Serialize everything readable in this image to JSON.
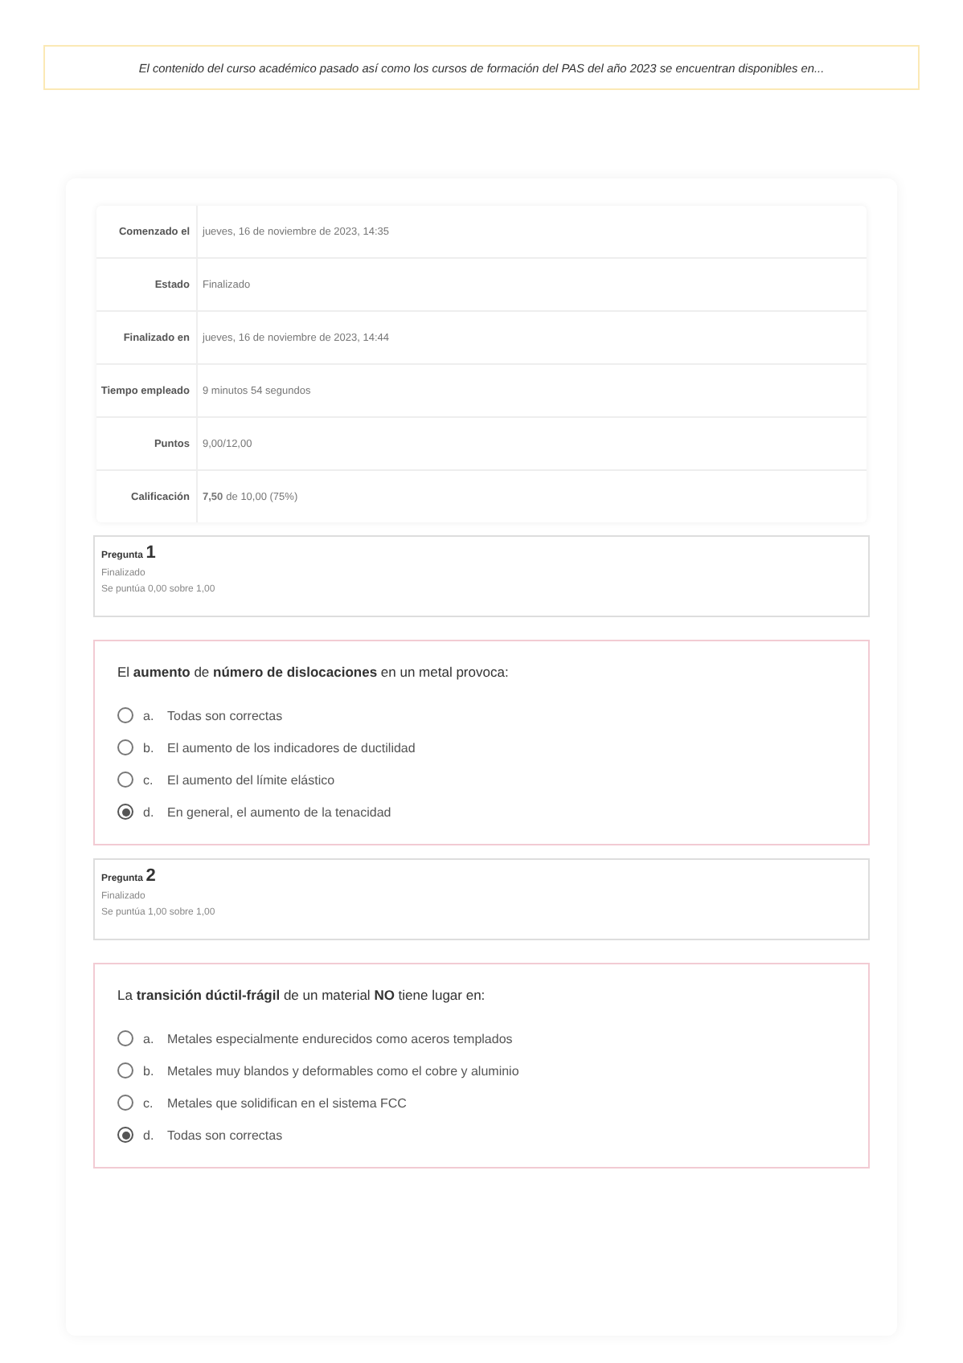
{
  "notice": "El contenido del curso académico pasado así como los cursos de formación del PAS del año 2023 se encuentran disponibles en...",
  "summary": [
    {
      "label": "Comenzado el",
      "value": "jueves, 16 de noviembre de 2023, 14:35"
    },
    {
      "label": "Estado",
      "value": "Finalizado"
    },
    {
      "label": "Finalizado en",
      "value": "jueves, 16 de noviembre de 2023, 14:44"
    },
    {
      "label": "Tiempo empleado",
      "value": "9 minutos 54 segundos"
    },
    {
      "label": "Puntos",
      "value": "9,00/12,00"
    },
    {
      "label": "Calificación",
      "value": "**7,50** de 10,00 (75%)"
    }
  ],
  "questions": [
    {
      "label": "Pregunta",
      "number": "1",
      "status": "Finalizado",
      "score": "Se puntúa 0,00 sobre 1,00",
      "text": "El **aumento** de **número de dislocaciones** en un metal provoca:",
      "options": [
        {
          "letter": "a.",
          "text": "Todas son correctas",
          "selected": false
        },
        {
          "letter": "b.",
          "text": "El aumento de los indicadores de ductilidad",
          "selected": false
        },
        {
          "letter": "c.",
          "text": "El aumento del límite elástico",
          "selected": false
        },
        {
          "letter": "d.",
          "text": "En general, el aumento de la tenacidad",
          "selected": true
        }
      ]
    },
    {
      "label": "Pregunta",
      "number": "2",
      "status": "Finalizado",
      "score": "Se puntúa 1,00 sobre 1,00",
      "text": "La **transición dúctil-frágil** de un material **NO** tiene lugar en:",
      "options": [
        {
          "letter": "a.",
          "text": "Metales especialmente endurecidos como aceros templados",
          "selected": false
        },
        {
          "letter": "b.",
          "text": "Metales muy blandos y deformables como el cobre y aluminio",
          "selected": false
        },
        {
          "letter": "c.",
          "text": "Metales que solidifican en el sistema FCC",
          "selected": false
        },
        {
          "letter": "d.",
          "text": "Todas son correctas",
          "selected": true
        }
      ]
    }
  ]
}
